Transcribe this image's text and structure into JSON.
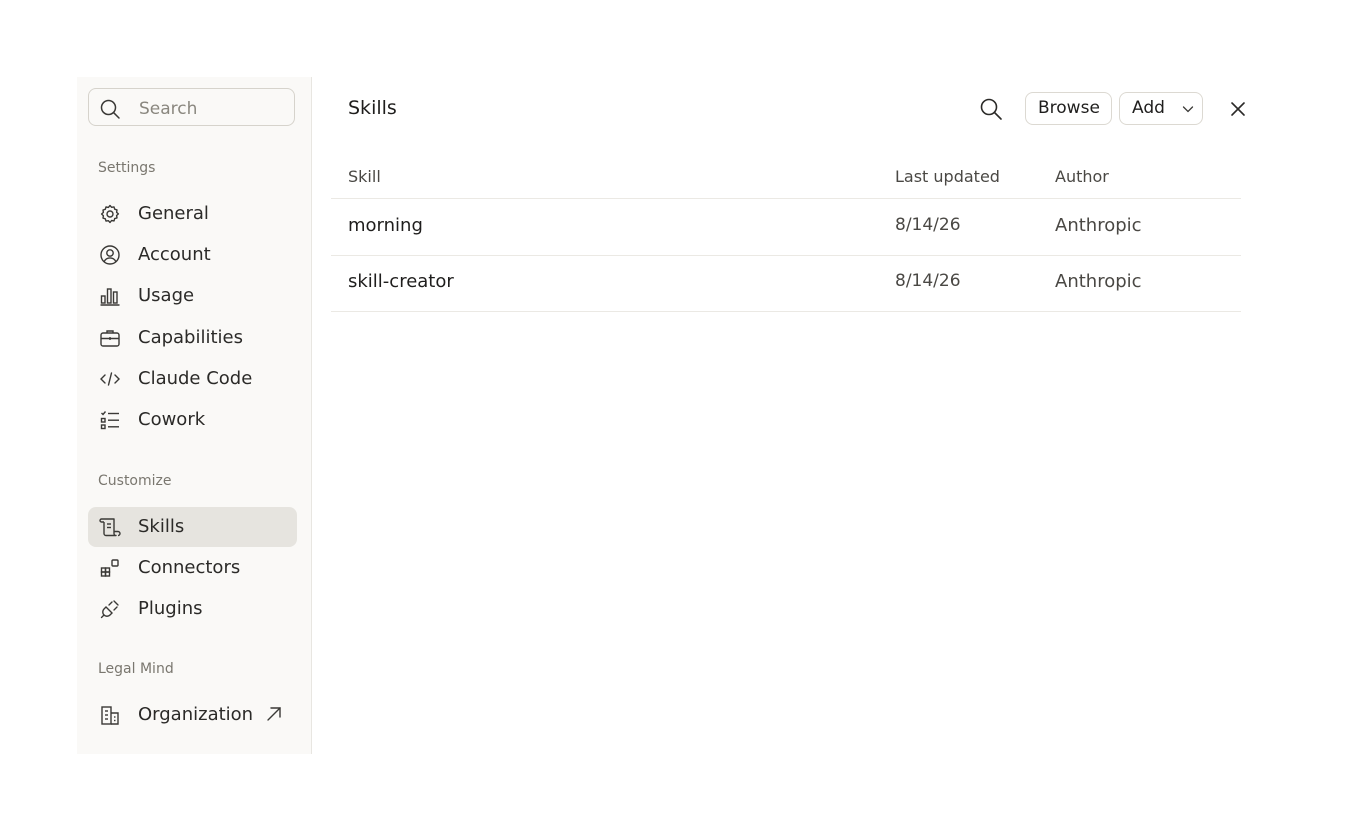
{
  "sidebar": {
    "search": {
      "placeholder": "Search",
      "icon": "search-icon"
    },
    "sections": [
      {
        "label": "Settings",
        "items": [
          {
            "label": "General",
            "icon": "gear-icon"
          },
          {
            "label": "Account",
            "icon": "user-circle-icon"
          },
          {
            "label": "Usage",
            "icon": "bar-chart-icon"
          },
          {
            "label": "Capabilities",
            "icon": "briefcase-icon"
          },
          {
            "label": "Claude Code",
            "icon": "code-icon"
          },
          {
            "label": "Cowork",
            "icon": "checklist-icon"
          }
        ]
      },
      {
        "label": "Customize",
        "items": [
          {
            "label": "Skills",
            "icon": "scroll-icon",
            "active": true
          },
          {
            "label": "Connectors",
            "icon": "grid-plus-icon"
          },
          {
            "label": "Plugins",
            "icon": "plug-icon"
          }
        ]
      },
      {
        "label": "Legal Mind",
        "items": [
          {
            "label": "Organization",
            "icon": "building-icon",
            "external": true
          }
        ]
      }
    ]
  },
  "main": {
    "title": "Skills",
    "browse_label": "Browse",
    "add_label": "Add",
    "table": {
      "columns": [
        "Skill",
        "Last updated",
        "Author"
      ],
      "rows": [
        {
          "skill": "morning",
          "last_updated": "8/14/26",
          "author": "Anthropic"
        },
        {
          "skill": "skill-creator",
          "last_updated": "8/14/26",
          "author": "Anthropic"
        }
      ]
    }
  },
  "colors": {
    "sidebar_bg": "#faf9f7",
    "active_item_bg": "#e6e4df",
    "border": "#ebe9e4",
    "text_primary": "#1f1e1d",
    "text_secondary": "#4a4844"
  }
}
